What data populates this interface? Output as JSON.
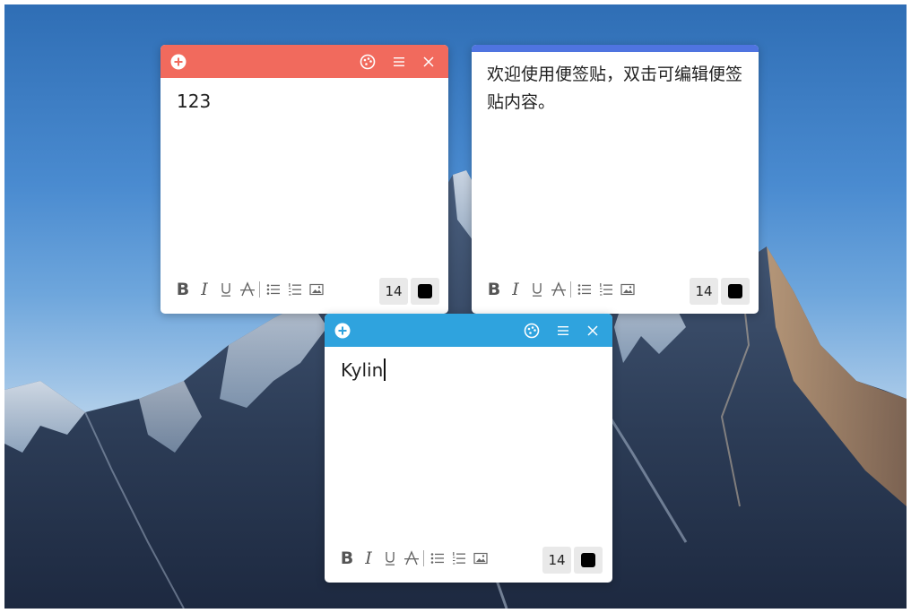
{
  "notes": [
    {
      "id": "note-1",
      "header_color": "#f16a5d",
      "content": "123",
      "font_size": "14",
      "text_color": "#000000"
    },
    {
      "id": "note-2",
      "header_color": "#4f74e0",
      "content": "欢迎使用便签贴，双击可编辑便签贴内容。",
      "font_size": "14",
      "text_color": "#000000"
    },
    {
      "id": "note-3",
      "header_color": "#2fa3de",
      "content": "Kylin",
      "font_size": "14",
      "text_color": "#000000",
      "editing": true
    }
  ],
  "header_icons": [
    "add-icon",
    "palette-icon",
    "menu-icon",
    "close-icon"
  ],
  "toolbar_icons": [
    "bold-icon",
    "italic-icon",
    "underline-icon",
    "strikethrough-icon",
    "bullet-list-icon",
    "numbered-list-icon",
    "insert-image-icon"
  ],
  "toolbar_glyphs": {
    "bold": "B",
    "italic": "I"
  }
}
